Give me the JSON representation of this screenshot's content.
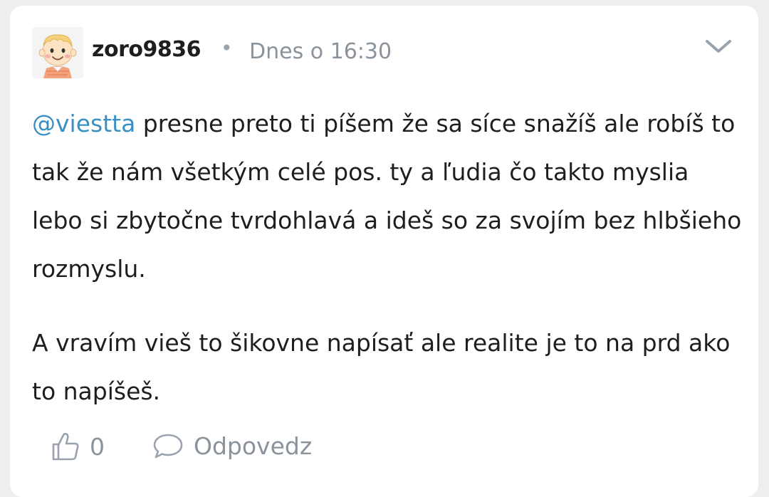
{
  "comment": {
    "username": "zoro9836",
    "separator": "•",
    "timestamp": "Dnes o 16:30",
    "mention": "@viestta",
    "paragraph1_rest": " presne preto ti píšem že sa síce snažíš ale robíš to tak že nám všetkým celé pos. ty a ľudia čo takto myslia lebo si zbytočne tvrdohlavá a ideš so za svojím bez hlbšieho rozmyslu.",
    "paragraph2": "A vravím vieš to šikovne napísať ale realite je to na prd ako to napíšeš."
  },
  "actions": {
    "like_count": "0",
    "reply_label": "Odpovedz"
  },
  "icons": {
    "avatar": "cartoon-boy-avatar",
    "menu": "chevron-down-icon",
    "like": "thumbs-up-icon",
    "reply": "speech-bubble-icon"
  },
  "colors": {
    "background": "#eceef0",
    "card": "#ffffff",
    "text": "#1e1e1e",
    "muted": "#8a939c",
    "mention": "#3a8fc4"
  }
}
